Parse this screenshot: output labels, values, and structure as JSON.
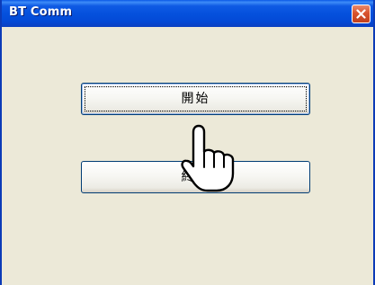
{
  "window": {
    "title": "BT Comm",
    "close_icon": "close-icon"
  },
  "buttons": {
    "start_label": "開始",
    "end_label": "終了"
  },
  "cursor": {
    "icon": "hand-pointer-icon"
  },
  "colors": {
    "titlebar": "#0551dd",
    "close": "#d9532d",
    "background": "#ece9d8",
    "button_border": "#003c74"
  }
}
